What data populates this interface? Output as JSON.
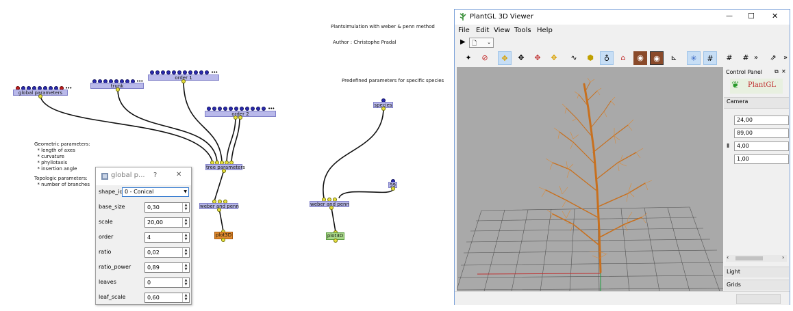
{
  "canvas": {
    "description_lines": [
      "Plantsimulation with weber & penn method",
      "Author : Christophe Pradal"
    ],
    "predefined_label": "Predefined parameters for specific species",
    "geometric_text": "Geometric parameters:\n  * length of axes\n  * curvature\n  * phyllotaxis\n  * insertion angle",
    "topologic_text": "Topologic parameters:\n  * number of branches",
    "nodes": {
      "global_parameters": "global parameters",
      "trunk": "trunk",
      "order1": "order 1",
      "order2": "order 2",
      "tree_parameters": "tree parameters",
      "weber_penn_left": "weber and penn",
      "plot3d_left": "plot3D",
      "species": "species",
      "node_99": "99",
      "weber_penn_right": "weber and penn",
      "plot3d_right": "plot3D"
    }
  },
  "dialog": {
    "title": "global p...",
    "help": "?",
    "close": "✕",
    "shape_id_label": "shape_id",
    "shape_id_value": "0 - Conical",
    "params": [
      {
        "label": "base_size",
        "value": "0,30"
      },
      {
        "label": "scale",
        "value": "20,00"
      },
      {
        "label": "order",
        "value": "4"
      },
      {
        "label": "ratio",
        "value": "0,02"
      },
      {
        "label": "ratio_power",
        "value": "0,89"
      },
      {
        "label": "leaves",
        "value": "0"
      },
      {
        "label": "leaf_scale",
        "value": "0,60"
      }
    ]
  },
  "viewer": {
    "title": "PlantGL 3D Viewer",
    "win_minimize": "—",
    "win_maximize": "☐",
    "win_close": "✕",
    "menu": [
      "File",
      "Edit",
      "View",
      "Tools",
      "Help"
    ],
    "more": "»",
    "control_panel": {
      "title": "Control Panel",
      "logo_text": "PlantGL",
      "camera_label": "Camera",
      "fields": [
        "24,00",
        "89,00",
        "4,00",
        "1,00"
      ],
      "light_label": "Light",
      "grids_label": "Grids"
    }
  },
  "colors": {
    "node_blue": "#b9b9ea",
    "node_orange": "#e08a2c",
    "node_green": "#a8d888",
    "viewport_bg": "#a9a9a9",
    "tree": "#c8701e"
  }
}
